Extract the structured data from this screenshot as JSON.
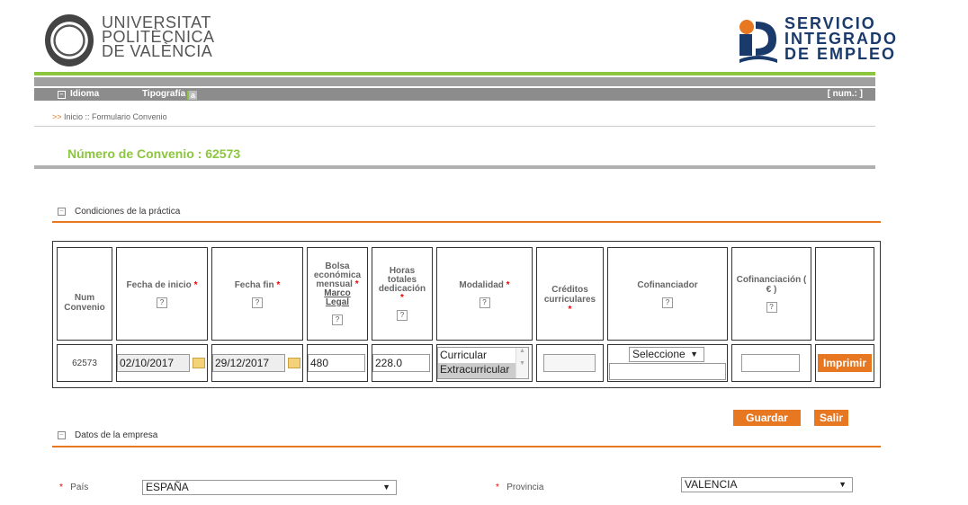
{
  "header": {
    "upv_lines": [
      "UNIVERSITAT",
      "POLITÈCNICA",
      "DE VALÈNCIA"
    ],
    "sie_lines": [
      "SERVICIO",
      "INTEGRADO",
      "DE EMPLEO"
    ]
  },
  "toolbar": {
    "idioma": "Idioma",
    "tipografia": "Tipografía",
    "typo_a1": "a",
    "typo_a2": "a",
    "num": "[ num.: ]"
  },
  "breadcrumb": {
    "arrows": ">>",
    "text": "Inicio :: Formulario Convenio"
  },
  "page_title": "Número de Convenio : 62573",
  "section1": {
    "title": "Condiciones de la práctica"
  },
  "table": {
    "headers": {
      "num_convenio": "Num Convenio",
      "fecha_inicio": "Fecha de inicio",
      "fecha_fin": "Fecha fin",
      "bolsa_1": "Bolsa económica mensual",
      "marco_legal": "Marco Legal",
      "horas": "Horas totales dedicación",
      "modalidad": "Modalidad",
      "creditos": "Créditos curriculares",
      "cofinanciador": "Cofinanciador",
      "cofinanciacion": "Cofinanciación ( € )",
      "req": "*",
      "help": "?"
    },
    "row": {
      "num_convenio": "62573",
      "fecha_inicio": "02/10/2017",
      "fecha_fin": "29/12/2017",
      "bolsa": "480",
      "horas": "228.0",
      "modalidad_options": [
        "Curricular",
        "Extracurricular"
      ],
      "modalidad_selected": "Extracurricular",
      "creditos": "",
      "cofinanciador": "Seleccione",
      "cofinanciacion": "",
      "imprimir": "Imprimir"
    }
  },
  "actions": {
    "guardar": "Guardar",
    "salir": "Salir"
  },
  "section2": {
    "title": "Datos de la empresa"
  },
  "empresa": {
    "pais_label": "País",
    "pais_value": "ESPAÑA",
    "provincia_label": "Provincia",
    "provincia_value": "VALENCIA",
    "req": "*"
  },
  "colors": {
    "accent_green": "#8cc63f",
    "accent_orange": "#e87722",
    "brand_blue": "#1a3a6b"
  }
}
